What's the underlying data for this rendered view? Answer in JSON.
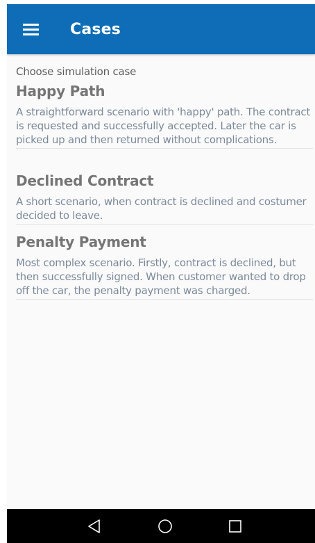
{
  "app_bar": {
    "title": "Cases",
    "icon": "menu-icon",
    "color": "#0e6db6"
  },
  "content": {
    "subtitle": "Choose simulation case",
    "cases": [
      {
        "title": "Happy Path",
        "description": "A straightforward scenario with 'happy' path. The contract is requested and successfully accepted. Later the car is picked up and then returned without complications."
      },
      {
        "title": "Declined Contract",
        "description": "A short scenario, when contract is declined and costumer decided to leave."
      },
      {
        "title": "Penalty Payment",
        "description": "Most complex scenario. Firstly, contract is declined, but then successfully signed. When customer wanted to drop off the car, the penalty payment was charged."
      }
    ]
  },
  "nav_bar": {
    "back_icon": "back-triangle-icon",
    "home_icon": "home-circle-icon",
    "recents_icon": "recents-square-icon"
  }
}
